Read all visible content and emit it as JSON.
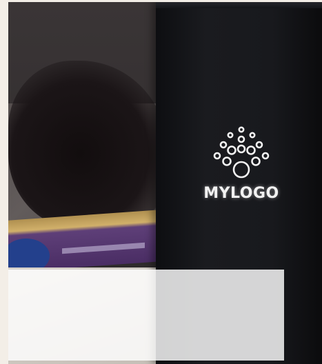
{
  "logo": {
    "text": "MYLOGO",
    "color": "#f2f2f2"
  },
  "bottle": {
    "color": "#18191d"
  },
  "overlay": {
    "color": "#ffffff"
  }
}
